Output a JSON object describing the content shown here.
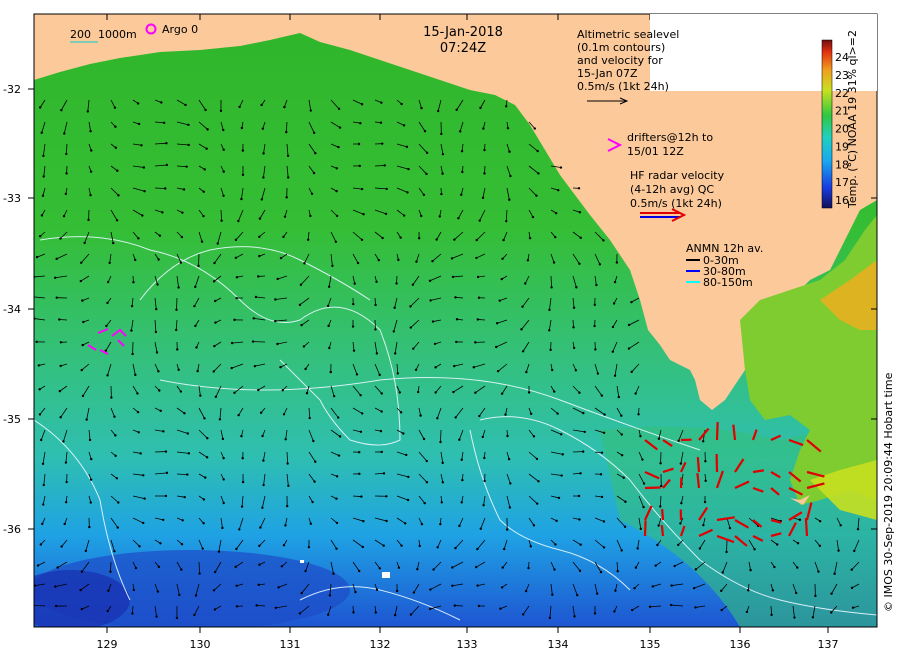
{
  "title": {
    "date": "15-Jan-2018",
    "time": "07:24Z"
  },
  "scale_bar": {
    "label_short": "200",
    "label_long": "1000m",
    "argo_label": "Argo 0"
  },
  "legend_altimetric": {
    "lines": [
      "Altimetric sealevel",
      "(0.1m contours)",
      "and velocity for",
      "15-Jan 07Z",
      "0.5m/s (1kt 24h)"
    ]
  },
  "legend_drifters": {
    "lines": [
      "drifters@12h to",
      "15/01 12Z"
    ],
    "color": "#ff00ff"
  },
  "legend_hf": {
    "lines": [
      "HF radar velocity",
      "(4-12h avg) QC",
      "0.5m/s (1kt 24h)"
    ],
    "color_main": "#e00000",
    "color_alt": "#0000e0"
  },
  "legend_anmn": {
    "title": "ANMN 12h av.",
    "items": [
      {
        "label": "0-30m",
        "color": "#000000"
      },
      {
        "label": "30-80m",
        "color": "#0000ff"
      },
      {
        "label": "80-150m",
        "color": "#00ffff"
      }
    ]
  },
  "colorbar": {
    "label": "Temp. (°C) NOAA 19 31% ql>=2",
    "ticks": [
      "16",
      "17",
      "18",
      "19",
      "20",
      "21",
      "22",
      "23",
      "24"
    ]
  },
  "x_axis": {
    "ticks": [
      "129",
      "130",
      "131",
      "132",
      "133",
      "134",
      "135",
      "136",
      "137"
    ]
  },
  "y_axis": {
    "ticks": [
      "-32",
      "-33",
      "-34",
      "-35",
      "-36"
    ]
  },
  "credit": "© IMOS 30-Sep-2019 20:09:44 Hobart time",
  "colors": {
    "land": "#fbc99a",
    "sea_warm": "#2bc22a",
    "sea_mid": "#33c98a",
    "sea_cool": "#1fa8e0",
    "sea_cold": "#1f4fd0",
    "contour": "#e8f8ff"
  }
}
